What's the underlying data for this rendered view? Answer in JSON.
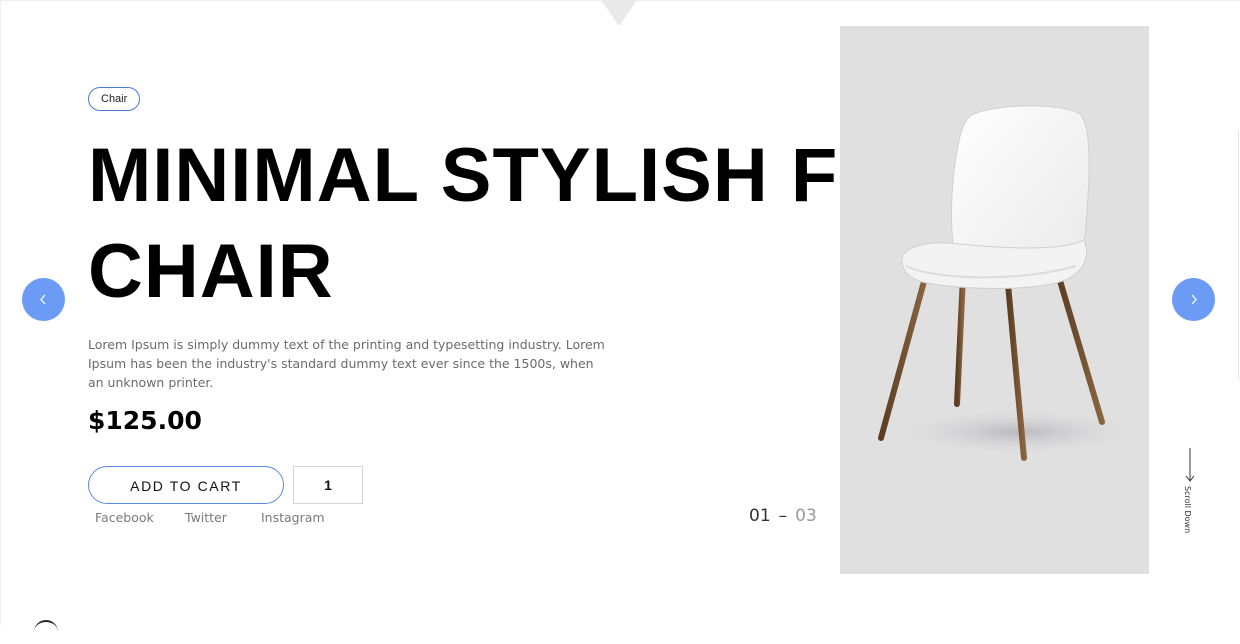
{
  "hero": {
    "tag": "Chair",
    "headline_line1": "MINIMAL STYLISH FURNITURE",
    "headline_line2": "CHAIR",
    "description": "Lorem Ipsum is simply dummy text of the printing and typesetting industry. Lorem Ipsum has been the industry's standard dummy text ever since the 1500s, when an unknown printer.",
    "price": "$125.00",
    "add_to_cart": "ADD TO CART",
    "quantity": "1"
  },
  "social": {
    "facebook": "Facebook",
    "twitter": "Twitter",
    "instagram": "Instagram"
  },
  "slider": {
    "current": "01",
    "separator": "–",
    "total": "03",
    "prev_icon": "chevron-left-icon",
    "next_icon": "chevron-right-icon"
  },
  "scroll": {
    "label": "Scroll Down",
    "icon": "arrow-down-icon"
  },
  "colors": {
    "accent": "#6b9bf5",
    "button_border": "#5b87e0",
    "image_bg": "#e0e0e0",
    "text": "#000000",
    "muted": "#6b6b6b"
  }
}
